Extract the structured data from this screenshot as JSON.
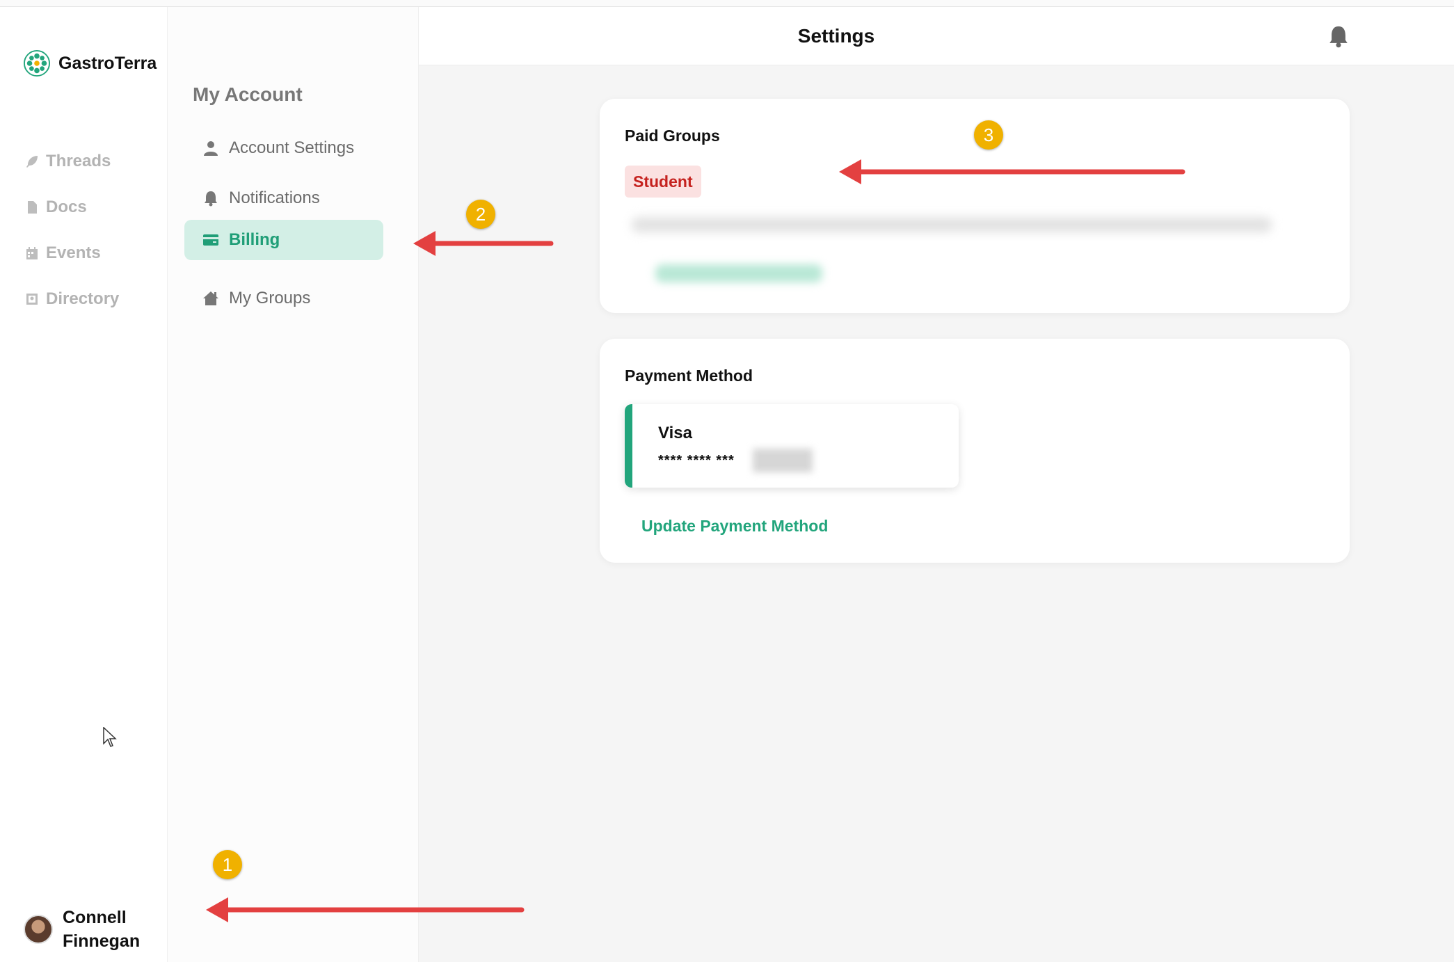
{
  "brand": {
    "name": "GastroTerra",
    "icon": "gastroterra-logo-icon"
  },
  "left_nav": {
    "items": [
      {
        "label": "Threads",
        "icon": "feather-icon"
      },
      {
        "label": "Docs",
        "icon": "document-icon"
      },
      {
        "label": "Events",
        "icon": "calendar-icon"
      },
      {
        "label": "Directory",
        "icon": "directory-icon"
      }
    ]
  },
  "user": {
    "name": "Connell Finnegan"
  },
  "sub_nav": {
    "title": "My Account",
    "items": [
      {
        "label": "Account Settings",
        "icon": "user-icon",
        "active": false
      },
      {
        "label": "Notifications",
        "icon": "bell-icon",
        "active": false
      },
      {
        "label": "Billing",
        "icon": "card-icon",
        "active": true
      },
      {
        "label": "My Groups",
        "icon": "home-icon",
        "active": false
      }
    ]
  },
  "header": {
    "title": "Settings",
    "icon": "bell-icon"
  },
  "paid_groups": {
    "title": "Paid Groups",
    "badge": "Student"
  },
  "payment_method": {
    "title": "Payment Method",
    "card_brand": "Visa",
    "card_number": "**** **** ***",
    "update_label": "Update Payment Method"
  },
  "annotations": {
    "markers": [
      "1",
      "2",
      "3"
    ]
  },
  "colors": {
    "accent": "#22a57c",
    "active_bg": "#d3efe6",
    "badge_bg": "#fbe1e1",
    "badge_text": "#c5221f",
    "marker": "#f0b100",
    "arrow": "#e34040"
  }
}
